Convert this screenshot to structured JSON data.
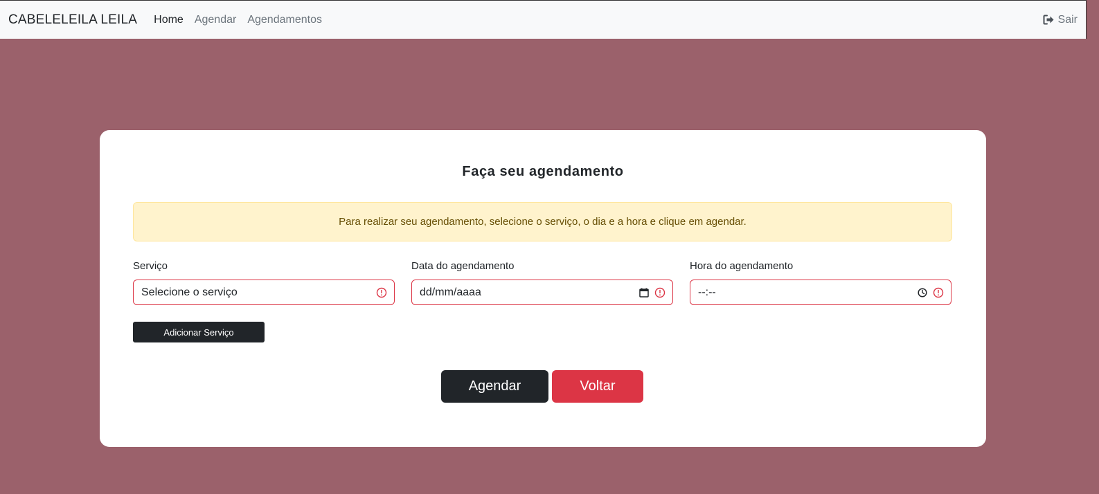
{
  "navbar": {
    "brand": "CABELELEILA LEILA",
    "links": [
      {
        "label": "Home",
        "active": true
      },
      {
        "label": "Agendar",
        "active": false
      },
      {
        "label": "Agendamentos",
        "active": false
      }
    ],
    "logout_label": "Sair",
    "logout_icon": "logout-icon"
  },
  "form": {
    "title": "Faça seu agendamento",
    "alert": "Para realizar seu agendamento, selecione o serviço, o dia e a hora e clique em agendar.",
    "service": {
      "label": "Serviço",
      "placeholder": "Selecione o serviço",
      "icon": "invalid-icon"
    },
    "date": {
      "label": "Data do agendamento",
      "placeholder": "dd/mm/aaaa",
      "icon": "calendar-icon"
    },
    "time": {
      "label": "Hora do agendamento",
      "placeholder": "--:--",
      "icon": "clock-icon"
    },
    "add_service_label": "Adicionar Serviço",
    "submit_label": "Agendar",
    "back_label": "Voltar"
  },
  "colors": {
    "background": "#9b616b",
    "navbar": "#f8f9fa",
    "danger": "#dc3545",
    "dark": "#212529",
    "alert_bg": "#fff3cd",
    "alert_text": "#664d03"
  }
}
